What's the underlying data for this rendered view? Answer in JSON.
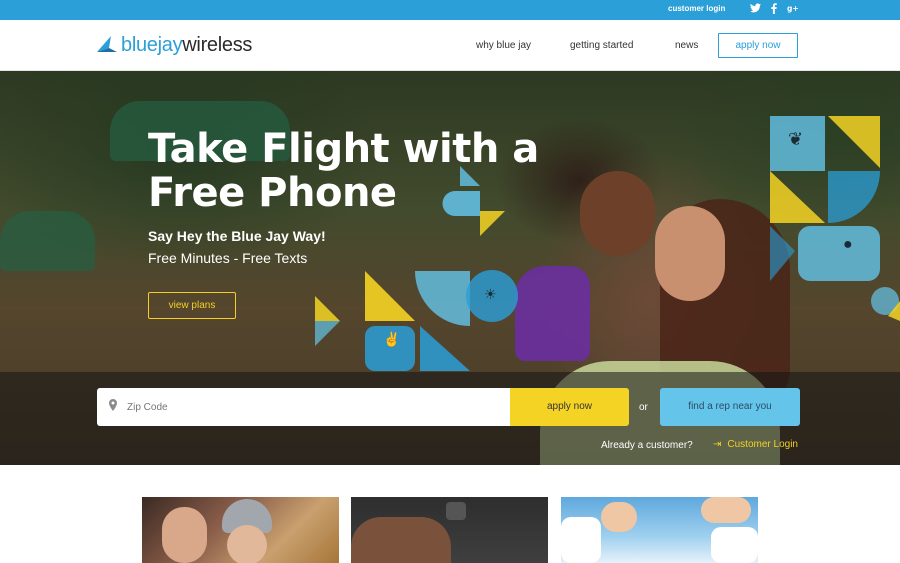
{
  "topbar": {
    "customer_login": "customer login",
    "social": [
      "twitter-icon",
      "facebook-icon",
      "google-plus-icon"
    ]
  },
  "brand": {
    "name_part1": "bluejay",
    "name_part2": "wireless",
    "color": "#2a9fd8"
  },
  "nav": {
    "items": [
      "why blue jay",
      "getting started",
      "news"
    ],
    "apply": "apply now"
  },
  "hero": {
    "headline_line1": "Take Flight with a",
    "headline_line2": "Free Phone",
    "subhead": "Say Hey the Blue Jay Way!",
    "tagline": "Free Minutes - Free Texts",
    "cta": "view plans"
  },
  "search": {
    "zip_placeholder": "Zip Code",
    "apply_button": "apply now",
    "or_text": "or",
    "find_rep_button": "find a rep near you",
    "already_customer": "Already a customer?",
    "customer_login": "Customer Login"
  },
  "colors": {
    "accent_blue": "#2a9fd8",
    "accent_yellow": "#f5d324",
    "light_blue": "#64c4ea"
  }
}
